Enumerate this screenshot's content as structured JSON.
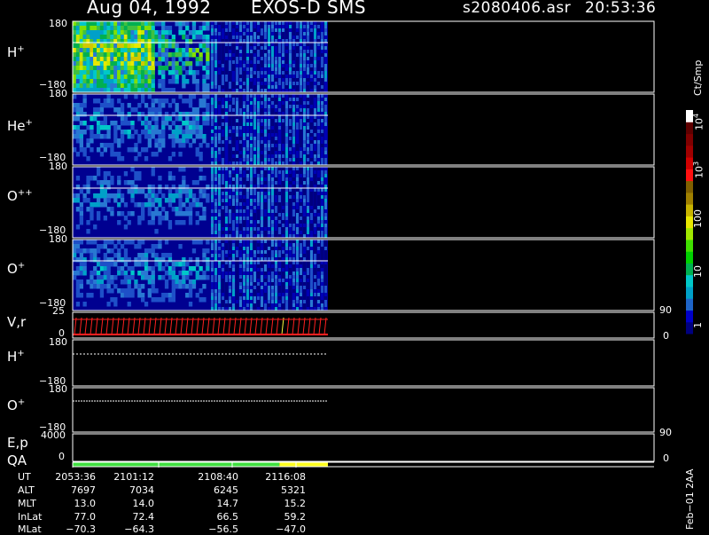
{
  "header": {
    "date": "Aug 04, 1992",
    "instrument": "EXOS-D SMS",
    "filename": "s2080406.asr",
    "time": "20:53:36"
  },
  "panels": {
    "h_plus": {
      "base": "H",
      "sup": "+",
      "ymax": "180",
      "ymin": "−180"
    },
    "he_plus": {
      "base": "He",
      "sup": "+",
      "ymax": "180",
      "ymin": "−180"
    },
    "o_pp": {
      "base": "O",
      "sup": "++",
      "ymax": "180",
      "ymin": "−180"
    },
    "o_plus": {
      "base": "O",
      "sup": "+",
      "ymax": "180",
      "ymin": "−180"
    },
    "vr": {
      "label": "V,r",
      "ymax": "25",
      "ymin": "0",
      "rmax": "90",
      "rmin": "0"
    },
    "h_plus_2": {
      "base": "H",
      "sup": "+",
      "ymax": "180",
      "ymin": "−180"
    },
    "o_plus_2": {
      "base": "O",
      "sup": "+",
      "ymax": "180",
      "ymin": "−180"
    },
    "ep": {
      "label": "E,p",
      "ymax": "4000",
      "ymin": "0",
      "rmax": "90",
      "rmin": "0"
    },
    "qa": {
      "label": "QA"
    }
  },
  "colorbar": {
    "unit": "Ct/Smp",
    "ticks": [
      "1",
      "10",
      "100"
    ],
    "ticks_pow": [
      {
        "base": "10",
        "exp": "3"
      },
      {
        "base": "10",
        "exp": "4"
      }
    ],
    "colors": [
      "#000080",
      "#0000c8",
      "#1e64c8",
      "#00a0c8",
      "#00c8c8",
      "#00b050",
      "#00d000",
      "#40e000",
      "#a0e800",
      "#e8e800",
      "#c8b400",
      "#a08000",
      "#806000",
      "#ff1010",
      "#d00000",
      "#a00000",
      "#800000",
      "#600000",
      "#ffffff"
    ]
  },
  "orbit": {
    "names": [
      "UT",
      "ALT",
      "MLT",
      "InLat",
      "MLat"
    ],
    "columns": [
      {
        "UT": "2053:36",
        "ALT": "7697",
        "MLT": "13.0",
        "InLat": "77.0",
        "MLat": "−70.3"
      },
      {
        "UT": "2101:12",
        "ALT": "7034",
        "MLT": "14.0",
        "InLat": "72.4",
        "MLat": "−64.3"
      },
      {
        "UT": "2108:40",
        "ALT": "6245",
        "MLT": "14.7",
        "InLat": "66.5",
        "MLat": "−56.5"
      },
      {
        "UT": "2116:08",
        "ALT": "5321",
        "MLT": "15.2",
        "InLat": "59.2",
        "MLat": "−47.0"
      }
    ]
  },
  "footer": {
    "date_code": "Feb−01 2AA"
  },
  "colors": {
    "qa_good": "#40e040",
    "qa_warn": "#ffff20",
    "vr_trace": "#ff2020",
    "vr_alt": "#ffff40"
  },
  "chart_data": {
    "type": "heatmap",
    "title": "Aug 04, 1992   EXOS-D SMS",
    "x_tick_labels": [
      "2053:36",
      "2101:12",
      "2108:40",
      "2116:08"
    ],
    "panels": [
      {
        "species": "H+",
        "ylim": [
          -180,
          180
        ]
      },
      {
        "species": "He+",
        "ylim": [
          -180,
          180
        ]
      },
      {
        "species": "O++",
        "ylim": [
          -180,
          180
        ]
      },
      {
        "species": "O+",
        "ylim": [
          -180,
          180
        ]
      },
      {
        "species": "V,r",
        "ylim": [
          0,
          25
        ],
        "right_ylim": [
          0,
          90
        ]
      },
      {
        "species": "H+",
        "ylim": [
          -180,
          180
        ]
      },
      {
        "species": "O+",
        "ylim": [
          -180,
          180
        ]
      },
      {
        "species": "E,p",
        "ylim": [
          0,
          4000
        ],
        "right_ylim": [
          0,
          90
        ]
      }
    ],
    "colorbar_scale": "log",
    "colorbar_range": [
      1,
      10000
    ],
    "colorbar_unit": "Ct/Smp",
    "qa_segments": [
      {
        "status": "good",
        "fraction": 0.81
      },
      {
        "status": "warn",
        "fraction": 0.19
      }
    ],
    "data_coverage_fraction": 0.44
  }
}
